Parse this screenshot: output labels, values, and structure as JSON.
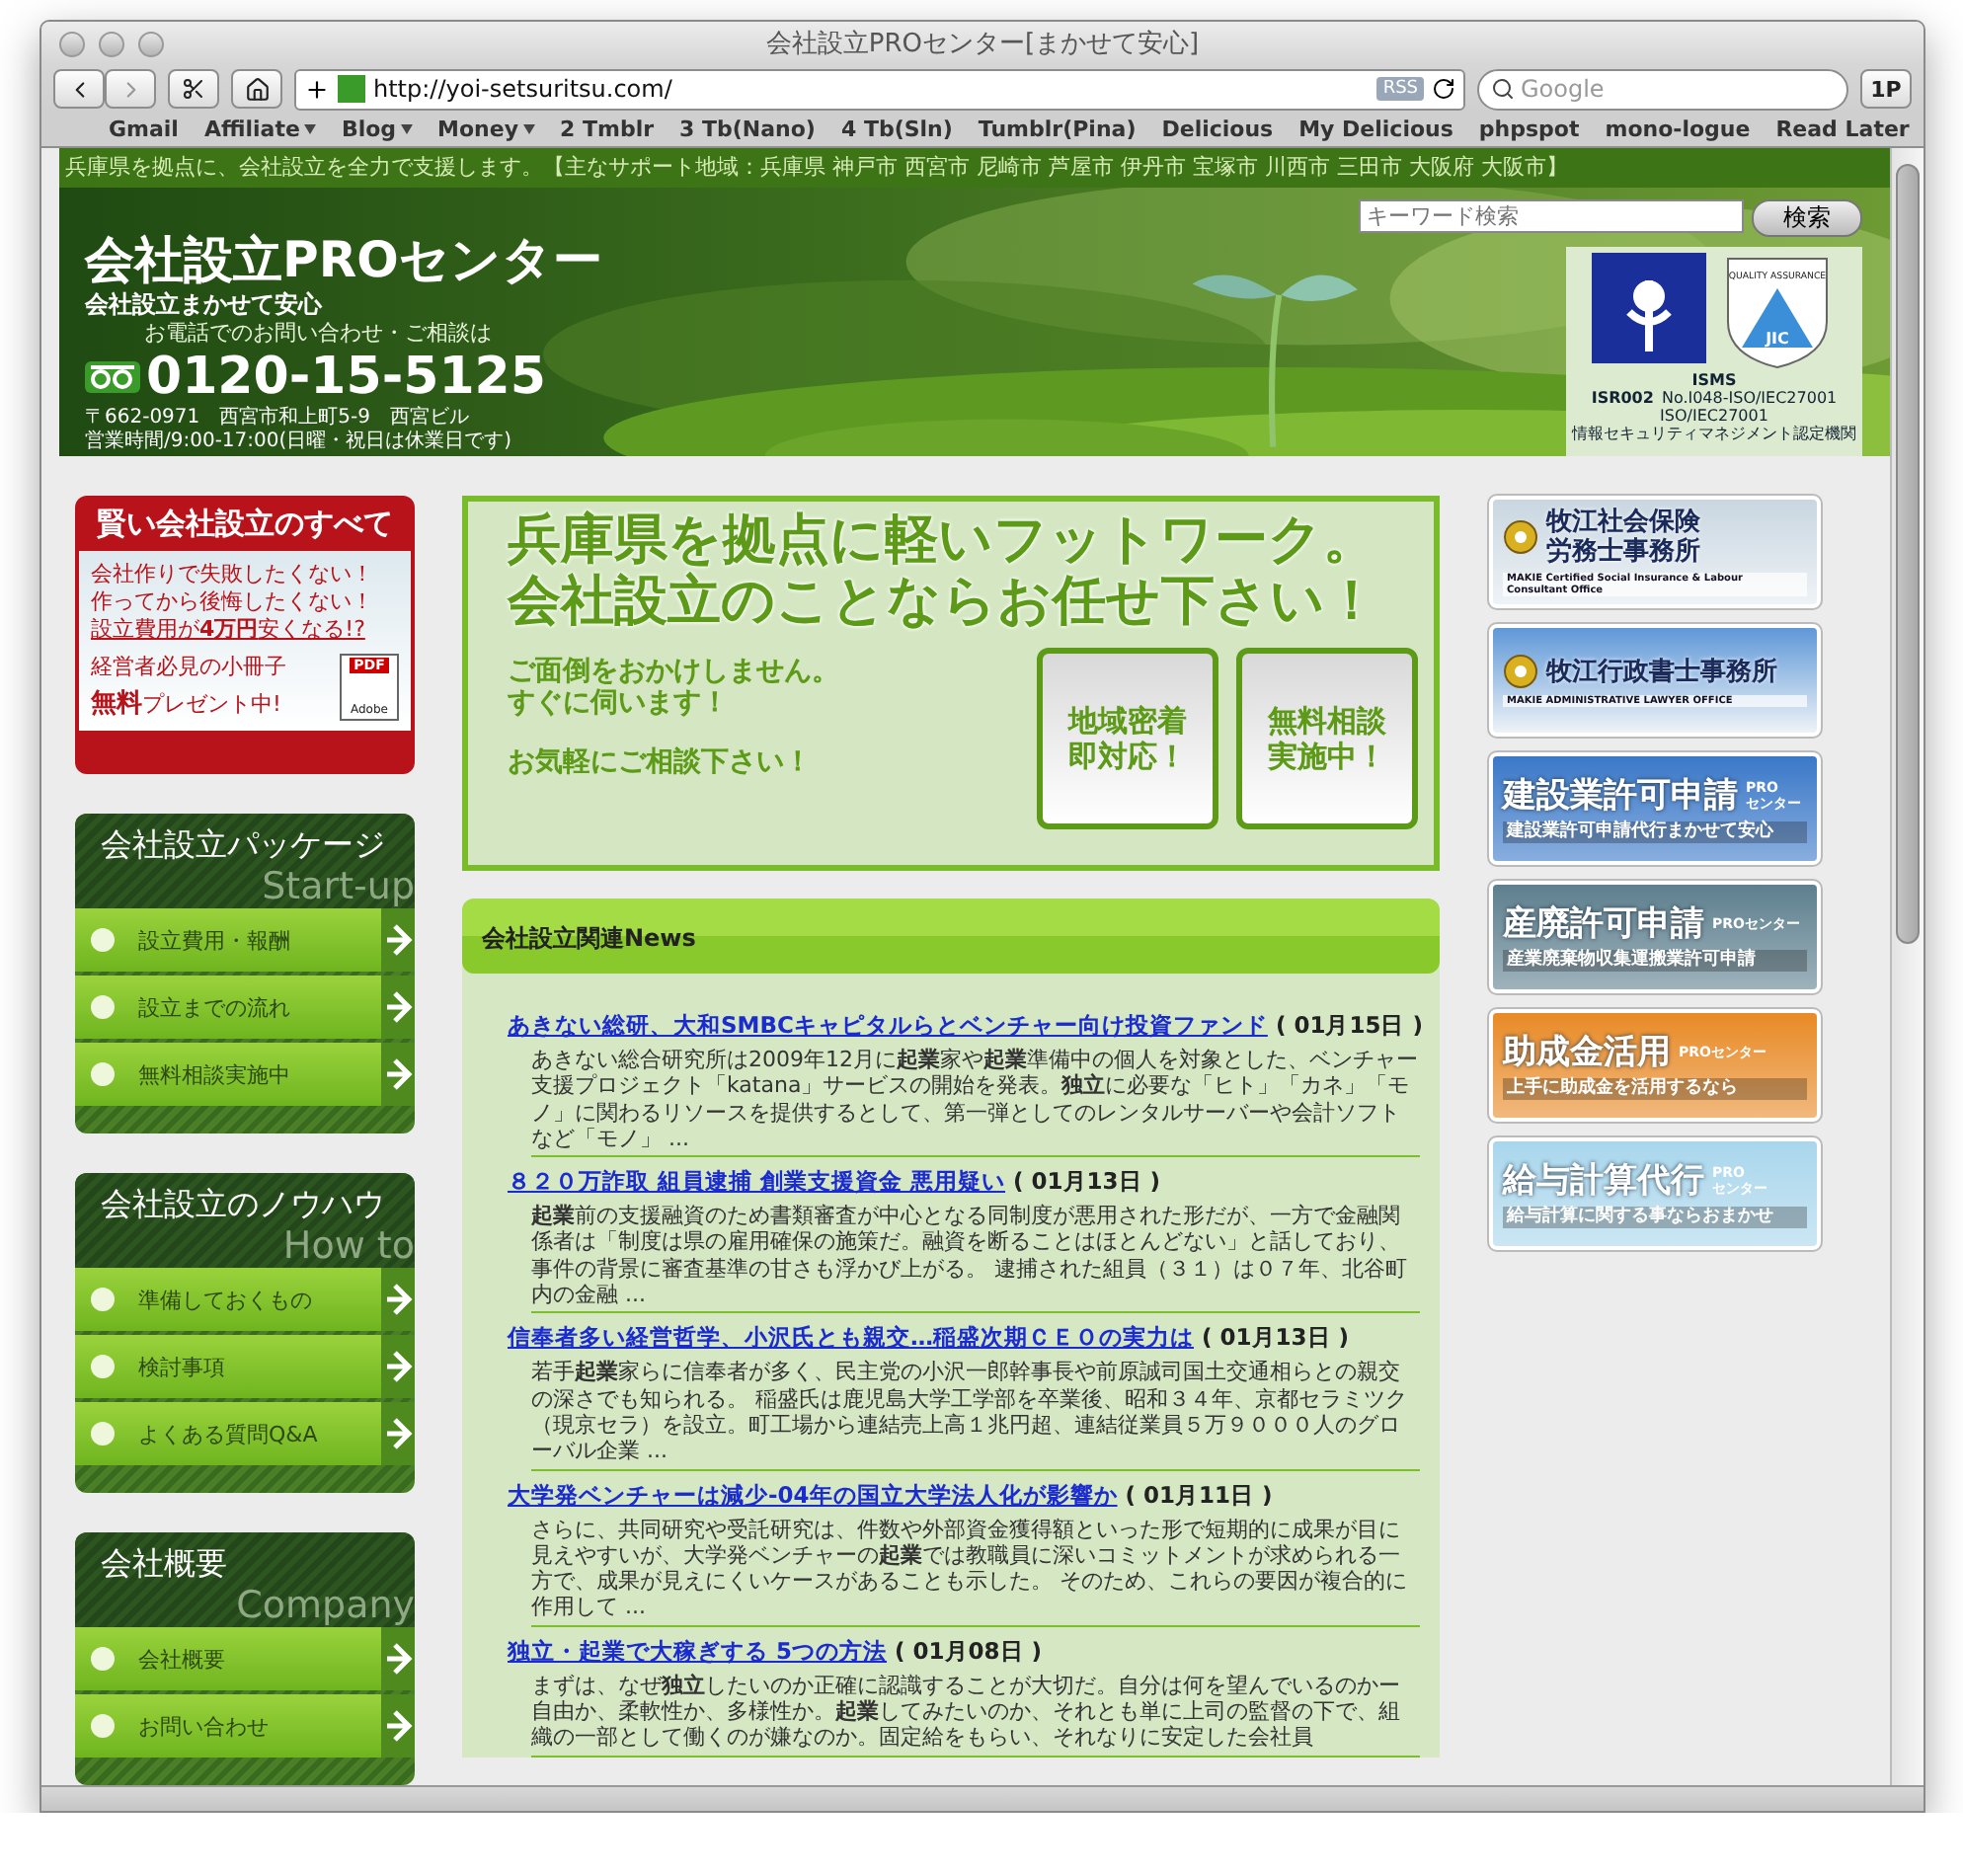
{
  "window": {
    "title": "会社設立PROセンター[まかせて安心]"
  },
  "toolbar": {
    "url": "http://yoi-setsuritsu.com/",
    "rss": "RSS",
    "search_placeholder": "Google",
    "extension_button": "1P"
  },
  "bookmarks": [
    {
      "label": "Gmail",
      "menu": false
    },
    {
      "label": "Affiliate",
      "menu": true
    },
    {
      "label": "Blog",
      "menu": true
    },
    {
      "label": "Money",
      "menu": true
    },
    {
      "label": "2 Tmblr",
      "menu": false
    },
    {
      "label": "3 Tb(Nano)",
      "menu": false
    },
    {
      "label": "4 Tb(Sln)",
      "menu": false
    },
    {
      "label": "Tumblr(Pina)",
      "menu": false
    },
    {
      "label": "Delicious",
      "menu": false
    },
    {
      "label": "My Delicious",
      "menu": false
    },
    {
      "label": "phpspot",
      "menu": false
    },
    {
      "label": "mono-logue",
      "menu": false
    },
    {
      "label": "Read Later",
      "menu": false
    }
  ],
  "top_strip": "兵庫県を拠点に、会社設立を全力で支援します。【主なサポート地域：兵庫県 神戸市 西宮市 尼崎市 芦屋市 伊丹市 宝塚市 川西市 三田市 大阪府 大阪市】",
  "header": {
    "site_name": "会社設立PROセンター",
    "tagline": "会社設立まかせて安心",
    "phone_note": "お電話でのお問い合わせ・ご相談は",
    "phone": "0120-15-5125",
    "address": "〒662-0971　西宮市和上町5-9　西宮ビル",
    "hours": "営業時間/9:00-17:00(日曜・祝日は休業日です)",
    "search_placeholder": "キーワード検索",
    "search_button": "検索",
    "certification": {
      "seal_text": "QUALITY ASSURANCE",
      "seal_mark": "JIC",
      "scheme": "ISMS",
      "registration": "ISR002",
      "number": "No.I048-ISO/IEC27001",
      "standard": "ISO/IEC27001",
      "body": "情報セキュリティマネジメント認定機関"
    }
  },
  "promo": {
    "title": "賢い会社設立のすべて",
    "lines": [
      "会社作りで失敗したくない！",
      "作ってから後悔したくない！",
      "設立費用が**4万円**安くなる!?"
    ],
    "booklet": "経営者必見の小冊子",
    "offer": "**無料**プレゼント中!",
    "pdf_label": "PDF",
    "pdf_brand": "Adobe"
  },
  "menus": [
    {
      "title": "会社設立パッケージ",
      "subtitle": "Start-up",
      "items": [
        "設立費用・報酬",
        "設立までの流れ",
        "無料相談実施中"
      ]
    },
    {
      "title": "会社設立のノウハウ",
      "subtitle": "How to",
      "items": [
        "準備しておくもの",
        "検討事項",
        "よくある質問Q&A"
      ]
    },
    {
      "title": "会社概要",
      "subtitle": "Company",
      "items": [
        "会社概要",
        "お問い合わせ"
      ]
    }
  ],
  "hero": {
    "headline": [
      "兵庫県を拠点に軽いフットワーク。",
      "会社設立のことならお任せ下さい！"
    ],
    "promise": [
      "ご面倒をおかけしません。",
      "すぐに伺います！"
    ],
    "invite": "お気軽にご相談下さい！",
    "badges": [
      [
        "地域密着",
        "即対応！"
      ],
      [
        "無料相談",
        "実施中！"
      ]
    ]
  },
  "news": {
    "title": "会社設立関連News",
    "items": [
      {
        "headline": "あきない総研、大和SMBCキャピタルらとベンチャー向け投資ファンド",
        "date": "( 01月15日 )",
        "summary": "あきない総合研究所は2009年12月に**起業**家や**起業**準備中の個人を対象とした、ベンチャー支援プロジェクト「katana」サービスの開始を発表。**独立**に必要な「ヒト」「カネ」「モノ」に関わるリソースを提供するとして、第一弾としてのレンタルサーバーや会計ソフトなど「モノ」 ..."
      },
      {
        "headline": "８２０万詐取 組員逮捕 創業支援資金 悪用疑い",
        "date": "( 01月13日 )",
        "summary": "**起業**前の支援融資のため書類審査が中心となる同制度が悪用された形だが、一方で金融関係者は「制度は県の雇用確保の施策だ。融資を断ることはほとんどない」と話しており、事件の背景に審査基準の甘さも浮かび上がる。 逮捕された組員（３１）は０７年、北谷町内の金融 ..."
      },
      {
        "headline": "信奉者多い経営哲学、小沢氏とも親交…稲盛次期ＣＥＯの実力は",
        "date": "( 01月13日 )",
        "summary": "若手**起業**家らに信奉者が多く、民主党の小沢一郎幹事長や前原誠司国土交通相らとの親交の深さでも知られる。 稲盛氏は鹿児島大学工学部を卒業後、昭和３４年、京都セラミツク（現京セラ）を設立。町工場から連結売上高１兆円超、連結従業員５万９０００人のグローバル企業 ..."
      },
      {
        "headline": "大学発ベンチャーは減少-04年の国立大学法人化が影響か",
        "date": "( 01月11日 )",
        "summary": "さらに、共同研究や受託研究は、件数や外部資金獲得額といった形で短期的に成果が目に見えやすいが、大学発ベンチャーの**起業**では教職員に深いコミットメントが求められる一方で、成果が見えにくいケースがあることも示した。 そのため、これらの要因が複合的に作用して ..."
      },
      {
        "headline": "独立・起業で大稼ぎする 5つの方法",
        "date": "( 01月08日 )",
        "summary": "まずは、なぜ**独立**したいのか正確に認識することが大切だ。自分は何を望んでいるのかー自由か、柔軟性か、多様性か。**起業**してみたいのか、それとも単に上司の監督の下で、組織の一部として働くのが嫌なのか。固定給をもらい、それなりに安定した会社員"
      }
    ]
  },
  "partner_banners": [
    {
      "kind": "office",
      "title_lines": [
        "牧江社会保険",
        "労務士事務所"
      ],
      "subtitle": "MAKIE Certified Social Insurance & Labour Consultant Office",
      "color": "#c9d6e0"
    },
    {
      "kind": "office",
      "title_lines": [
        "牧江行政書士事務所"
      ],
      "subtitle": "MAKIE ADMINISTRATIVE LAWYER OFFICE",
      "color": "#5f98d8"
    },
    {
      "kind": "pro",
      "title": "建設業許可申請",
      "badge": [
        "PRO",
        "センター"
      ],
      "subtitle": "建設業許可申請代行まかせて安心",
      "color": "#3a78c8"
    },
    {
      "kind": "pro",
      "title": "産廃許可申請",
      "badge": [
        "PROセンター"
      ],
      "subtitle": "産業廃棄物収集運搬業許可申請",
      "color": "#5d7f8e"
    },
    {
      "kind": "pro",
      "title": "助成金活用",
      "badge": [
        "PROセンター"
      ],
      "subtitle": "上手に助成金を活用するなら",
      "color": "#e88a26"
    },
    {
      "kind": "pro",
      "title": "給与計算代行",
      "badge": [
        "PRO",
        "センター"
      ],
      "subtitle": "給与計算に関する事ならおまかせ",
      "color": "#a9d6ec"
    }
  ]
}
